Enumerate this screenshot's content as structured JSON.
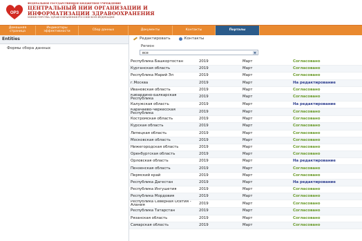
{
  "header": {
    "logo_text": "ОРЗ",
    "org_line1": "ФЕДЕРАЛЬНОЕ ГОСУДАРСТВЕННОЕ БЮДЖЕТНОЕ УЧРЕЖДЕНИЕ",
    "org_line2": "ЦЕНТРАЛЬНЫЙ НИИ ОРГАНИЗАЦИИ И",
    "org_line3": "ИНФОРМАТИЗАЦИИ ЗДРАВООХРАНЕНИЯ",
    "org_line4": "МИНИСТЕРСТВА ЗДРАВООХРАНЕНИЯ РОССИЙСКОЙ ФЕДЕРАЦИИ"
  },
  "nav": {
    "tabs": [
      {
        "label": "Домашняя страница"
      },
      {
        "label": "Индикаторы эффективности"
      },
      {
        "label": "Сбор данных"
      },
      {
        "label": "Документы"
      },
      {
        "label": "Контакты"
      },
      {
        "label": "Порталы",
        "active": true
      }
    ]
  },
  "left": {
    "header": "Entities",
    "item": "Формы сбора данных"
  },
  "toolbar": {
    "edit": "Редактировать",
    "contacts": "Контакты"
  },
  "filter": {
    "label": "Регион",
    "value": "все"
  },
  "colors": {
    "approved": "#6a9a2b",
    "editing": "#2f3f8f",
    "nav_bg": "#e9892f",
    "nav_active": "#2b5b8a"
  },
  "rows": [
    {
      "region": "Республика Башкортостан",
      "year": "2019",
      "month": "Март",
      "status": "Согласовано",
      "kind": "ok"
    },
    {
      "region": "Курганская область",
      "year": "2019",
      "month": "Март",
      "status": "Согласовано",
      "kind": "ok"
    },
    {
      "region": "Республика Марий Эл",
      "year": "2019",
      "month": "Март",
      "status": "Согласовано",
      "kind": "ok"
    },
    {
      "region": "г.Москва",
      "year": "2019",
      "month": "Март",
      "status": "На редактирование",
      "kind": "edit"
    },
    {
      "region": "Ивановская область",
      "year": "2019",
      "month": "Март",
      "status": "Согласовано",
      "kind": "ok"
    },
    {
      "region": "Кабардино-Балкарская Республика",
      "year": "2019",
      "month": "Март",
      "status": "Согласовано",
      "kind": "ok"
    },
    {
      "region": "Калужская область",
      "year": "2019",
      "month": "Март",
      "status": "На редактирование",
      "kind": "edit"
    },
    {
      "region": "Карачаево-Черкесская Республика",
      "year": "2019",
      "month": "Март",
      "status": "Согласовано",
      "kind": "ok"
    },
    {
      "region": "Костромская область",
      "year": "2019",
      "month": "Март",
      "status": "Согласовано",
      "kind": "ok"
    },
    {
      "region": "Курская область",
      "year": "2019",
      "month": "Март",
      "status": "Согласовано",
      "kind": "ok"
    },
    {
      "region": "Липецкая область",
      "year": "2019",
      "month": "Март",
      "status": "Согласовано",
      "kind": "ok"
    },
    {
      "region": "Московская область",
      "year": "2019",
      "month": "Март",
      "status": "Согласовано",
      "kind": "ok"
    },
    {
      "region": "Нижегородская область",
      "year": "2019",
      "month": "Март",
      "status": "Согласовано",
      "kind": "ok"
    },
    {
      "region": "Оренбургская область",
      "year": "2019",
      "month": "Март",
      "status": "Согласовано",
      "kind": "ok"
    },
    {
      "region": "Орловская область",
      "year": "2019",
      "month": "Март",
      "status": "На редактирование",
      "kind": "edit"
    },
    {
      "region": "Пензенская область",
      "year": "2019",
      "month": "Март",
      "status": "Согласовано",
      "kind": "ok"
    },
    {
      "region": "Пермский край",
      "year": "2019",
      "month": "Март",
      "status": "Согласовано",
      "kind": "ok"
    },
    {
      "region": "Республика Дагестан",
      "year": "2019",
      "month": "Март",
      "status": "На редактирование",
      "kind": "edit"
    },
    {
      "region": "Республика Ингушетия",
      "year": "2019",
      "month": "Март",
      "status": "Согласовано",
      "kind": "ok"
    },
    {
      "region": "Республика Мордовия",
      "year": "2019",
      "month": "Март",
      "status": "Согласовано",
      "kind": "ok"
    },
    {
      "region": "Республика Северная Осетия - Алания",
      "year": "2019",
      "month": "Март",
      "status": "Согласовано",
      "kind": "ok"
    },
    {
      "region": "Республика Татарстан",
      "year": "2019",
      "month": "Март",
      "status": "Согласовано",
      "kind": "ok"
    },
    {
      "region": "Рязанская область",
      "year": "2019",
      "month": "Март",
      "status": "Согласовано",
      "kind": "ok"
    },
    {
      "region": "Самарская область",
      "year": "2019",
      "month": "Март",
      "status": "Согласовано",
      "kind": "ok"
    }
  ]
}
